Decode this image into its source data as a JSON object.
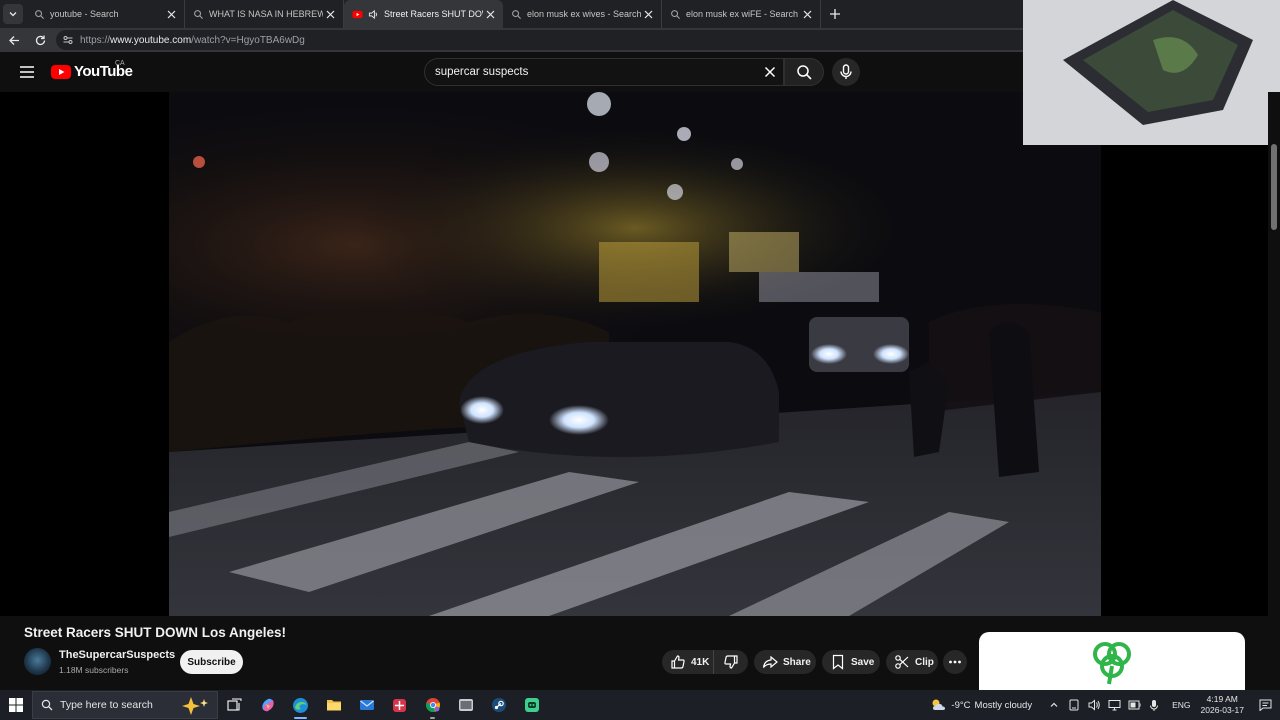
{
  "browser": {
    "tabs": [
      {
        "title": "youtube - Search",
        "icon": "search-icon",
        "active": false
      },
      {
        "title": "WHAT IS NASA IN HEBREW - Search",
        "icon": "search-icon",
        "active": false
      },
      {
        "title": "Street Racers SHUT DOWN Los Angeles!",
        "icon": "youtube-icon",
        "active": true,
        "audio": true
      },
      {
        "title": "elon musk ex wives - Search",
        "icon": "search-icon",
        "active": false
      },
      {
        "title": "elon musk ex wiFE - Search Images",
        "icon": "search-icon",
        "active": false
      }
    ],
    "url": {
      "protocol": "https://",
      "host": "www.youtube.com",
      "path": "/watch?v=HgyoTBA6wDg"
    }
  },
  "youtube": {
    "logo_text": "YouTube",
    "region": "CA",
    "search_value": "supercar suspects",
    "video": {
      "title": "Street Racers SHUT DOWN Los Angeles!",
      "channel": "TheSupercarSuspects",
      "subscribers": "1.18M subscribers",
      "subscribe_label": "Subscribe",
      "likes": "41K",
      "share_label": "Share",
      "save_label": "Save",
      "clip_label": "Clip"
    }
  },
  "taskbar": {
    "search_placeholder": "Type here to search",
    "weather_temp": "-9°C",
    "weather_text": "Mostly cloudy",
    "language": "ENG",
    "time": "4:19 AM",
    "date": "2026-03-17"
  },
  "colors": {
    "youtube_red": "#ff0000",
    "page_bg": "#0f0f0f",
    "tab_bar": "#202124",
    "ad_green": "#2fb54a"
  }
}
